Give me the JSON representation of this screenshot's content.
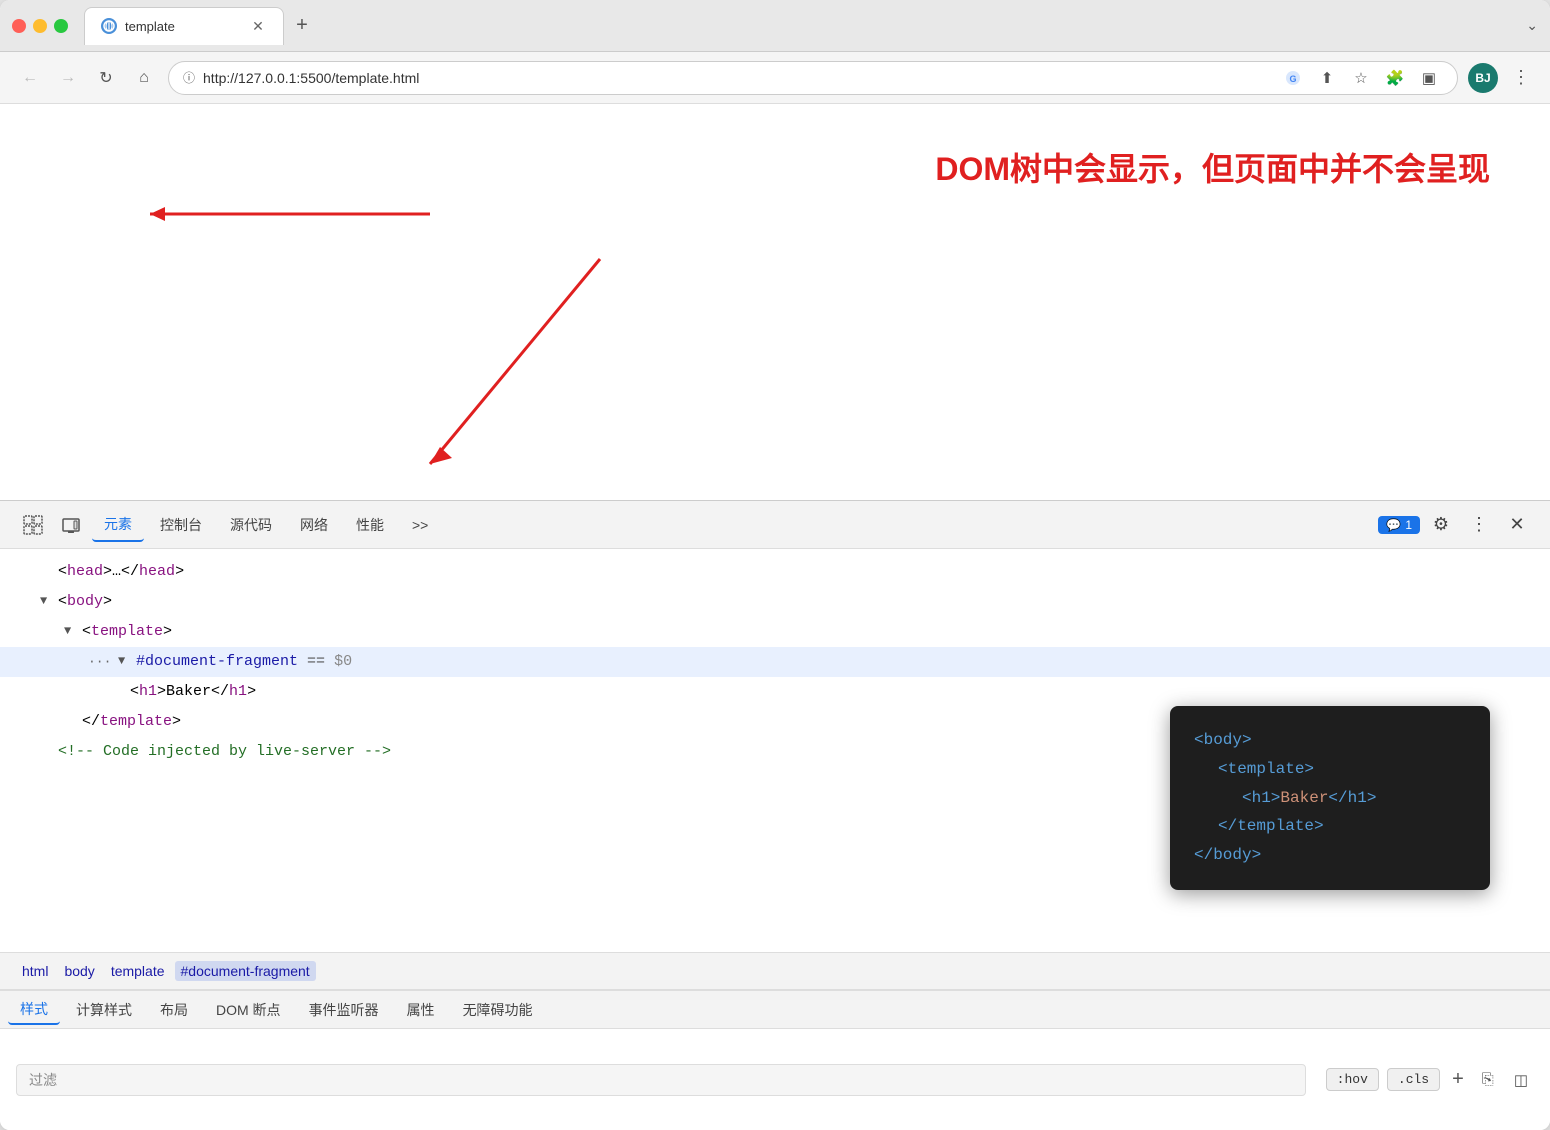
{
  "browser": {
    "traffic_lights": [
      "red",
      "yellow",
      "green"
    ],
    "tab": {
      "title": "template",
      "icon_label": "globe"
    },
    "new_tab_label": "+",
    "chevron_label": "⌄",
    "url": "http://127.0.0.1:5500/template.html",
    "nav": {
      "back_label": "←",
      "forward_label": "→",
      "reload_label": "↻",
      "home_label": "⌂"
    },
    "url_actions": {
      "translate_label": "G",
      "share_label": "⬆",
      "star_label": "☆",
      "extension_label": "⚙",
      "sidebar_label": "▣"
    },
    "avatar": "BJ",
    "more_label": "⋮"
  },
  "annotation": {
    "text": "DOM树中会显示，但页面中并不会呈现"
  },
  "devtools": {
    "toolbar": {
      "inspect_icon": "⠿",
      "device_icon": "⬜",
      "tabs": [
        "元素",
        "控制台",
        "源代码",
        "网络",
        "性能",
        ">>"
      ],
      "active_tab": "元素",
      "badge_icon": "💬",
      "badge_count": "1",
      "settings_icon": "⚙",
      "more_icon": "⋮",
      "close_icon": "✕"
    },
    "dom_tree": {
      "lines": [
        {
          "indent": 1,
          "triangle": "none",
          "html": "&lt;<span class='tag'>head</span>&gt;…&lt;/<span class='tag'>head</span>&gt;"
        },
        {
          "indent": 1,
          "triangle": "open",
          "html": "&lt;<span class='tag'>body</span>&gt;"
        },
        {
          "indent": 2,
          "triangle": "open",
          "html": "&lt;<span class='tag'>template</span>&gt;"
        },
        {
          "indent": 3,
          "triangle": "open",
          "html": "<span class='dom-id'>#document-fragment</span> <span class='dom-eq'>==</span> <span class='dom-dollar'>$0</span>",
          "selected": true,
          "has_ellipsis": true
        },
        {
          "indent": 4,
          "triangle": "none",
          "html": "&lt;<span class='tag'>h1</span>&gt;Baker&lt;/<span class='tag'>h1</span>&gt;"
        },
        {
          "indent": 2,
          "triangle": "none",
          "html": "&lt;/<span class='tag'>template</span>&gt;"
        },
        {
          "indent": 1,
          "triangle": "none",
          "html": "&lt;<span class='comment'>!-- Code injected by live-server --</span>&gt;"
        }
      ]
    },
    "breadcrumbs": [
      "html",
      "body",
      "template",
      "#document-fragment"
    ],
    "styles_tabs": [
      "样式",
      "计算样式",
      "布局",
      "DOM 断点",
      "事件监听器",
      "属性",
      "无障碍功能"
    ],
    "active_styles_tab": "样式",
    "filter_placeholder": "过滤",
    "filter_actions": {
      "hov_label": ":hov",
      "cls_label": ".cls",
      "plus_label": "+",
      "copy_icon": "⎘",
      "dock_icon": "◫"
    }
  },
  "code_popup": {
    "lines": [
      {
        "text": "<body>",
        "indent": 0
      },
      {
        "text": "<template>",
        "indent": 1
      },
      {
        "text": "<h1>Baker</h1>",
        "indent": 2
      },
      {
        "text": "</template>",
        "indent": 1
      },
      {
        "text": "</body>",
        "indent": 0
      }
    ]
  }
}
